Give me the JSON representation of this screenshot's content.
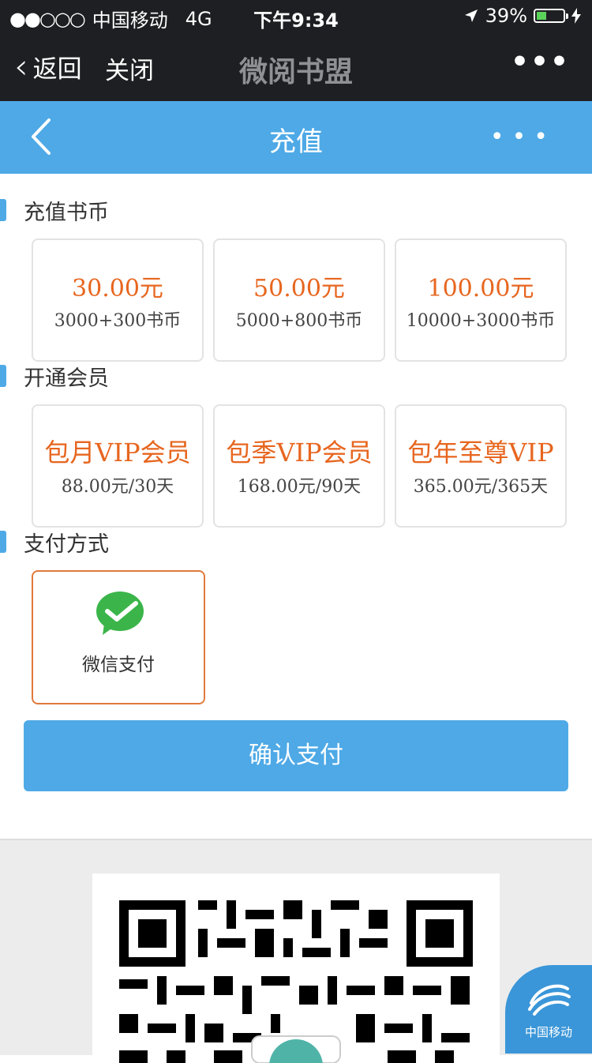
{
  "status_bar": {
    "signal_dots": "●●○○○",
    "carrier": "中国移动",
    "network": "4G",
    "time": "下午9:34",
    "battery_percent": "39%",
    "battery_level": 0.39
  },
  "wechat_bar": {
    "back_label": "返回",
    "close_label": "关闭",
    "title": "微阅书盟",
    "more_glyph": "•••"
  },
  "app_bar": {
    "title": "充值",
    "more_glyph": "•••"
  },
  "recharge": {
    "section_title": "充值书币",
    "options": [
      {
        "price": "30.00元",
        "coins": "3000+300书币"
      },
      {
        "price": "50.00元",
        "coins": "5000+800书币"
      },
      {
        "price": "100.00元",
        "coins": "10000+3000书币"
      }
    ]
  },
  "membership": {
    "section_title": "开通会员",
    "options": [
      {
        "name": "包月VIP会员",
        "detail": "88.00元/30天"
      },
      {
        "name": "包季VIP会员",
        "detail": "168.00元/90天"
      },
      {
        "name": "包年至尊VIP",
        "detail": "365.00元/365天"
      }
    ]
  },
  "payment": {
    "section_title": "支付方式",
    "method_label": "微信支付",
    "method_icon": "wechat-pay-icon"
  },
  "confirm_button": "确认支付",
  "badge": {
    "label": "中国移动"
  },
  "colors": {
    "accent_blue": "#4ea9e6",
    "price_orange": "#e7661f",
    "selected_border": "#e07a3c",
    "wechat_green": "#3bb54a"
  }
}
